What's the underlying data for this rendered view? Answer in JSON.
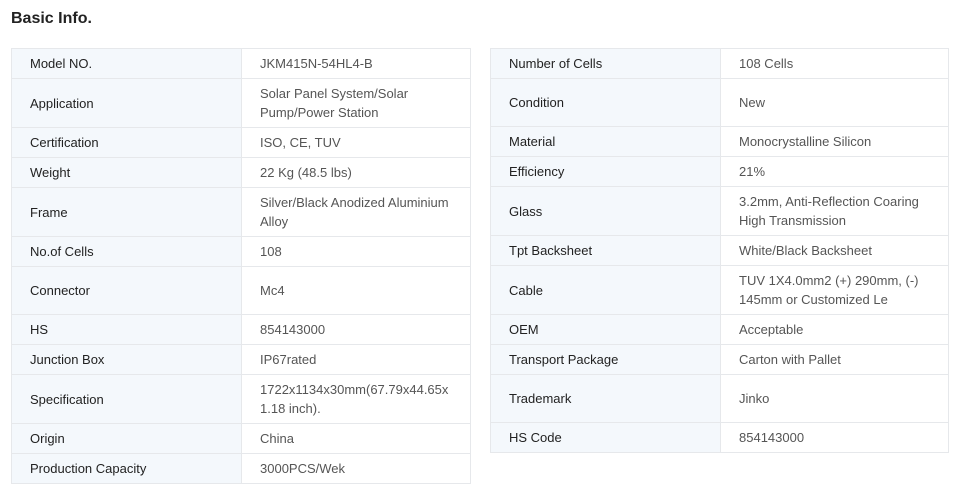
{
  "section": {
    "title": "Basic Info."
  },
  "left_table": [
    {
      "label": "Model NO.",
      "value": "JKM415N-54HL4-B",
      "rows": 1
    },
    {
      "label": "Application",
      "value": "Solar Panel System/Solar Pump/Power Station",
      "rows": 2
    },
    {
      "label": "Certification",
      "value": "ISO, CE, TUV",
      "rows": 1
    },
    {
      "label": "Weight",
      "value": "22 Kg (48.5 lbs)",
      "rows": 1
    },
    {
      "label": "Frame",
      "value": "Silver/Black Anodized Aluminium Alloy",
      "rows": 2
    },
    {
      "label": "No.of Cells",
      "value": "108",
      "rows": 1
    },
    {
      "label": "Connector",
      "value": "Mc4",
      "rows": 2
    },
    {
      "label": "HS",
      "value": "854143000",
      "rows": 1
    },
    {
      "label": "Junction Box",
      "value": "IP67rated",
      "rows": 1
    },
    {
      "label": "Specification",
      "value": "1722x1134x30mm(67.79x44.65x 1.18 inch).",
      "rows": 2
    },
    {
      "label": "Origin",
      "value": "China",
      "rows": 1
    },
    {
      "label": "Production Capacity",
      "value": "3000PCS/Wek",
      "rows": 1
    }
  ],
  "right_table": [
    {
      "label": "Number of Cells",
      "value": "108 Cells",
      "rows": 1
    },
    {
      "label": "Condition",
      "value": "New",
      "rows": 2
    },
    {
      "label": "Material",
      "value": "Monocrystalline Silicon",
      "rows": 1
    },
    {
      "label": "Efficiency",
      "value": "21%",
      "rows": 1
    },
    {
      "label": "Glass",
      "value": "3.2mm, Anti-Reflection Coaring High Transmission",
      "rows": 2
    },
    {
      "label": "Tpt Backsheet",
      "value": "White/Black Backsheet",
      "rows": 1
    },
    {
      "label": "Cable",
      "value": "TUV 1X4.0mm2 (+) 290mm, (-) 145mm or Customized Le",
      "rows": 2
    },
    {
      "label": "OEM",
      "value": "Acceptable",
      "rows": 1
    },
    {
      "label": "Transport Package",
      "value": "Carton with Pallet",
      "rows": 1
    },
    {
      "label": "Trademark",
      "value": "Jinko",
      "rows": 2
    },
    {
      "label": "HS Code",
      "value": "854143000",
      "rows": 1
    }
  ]
}
